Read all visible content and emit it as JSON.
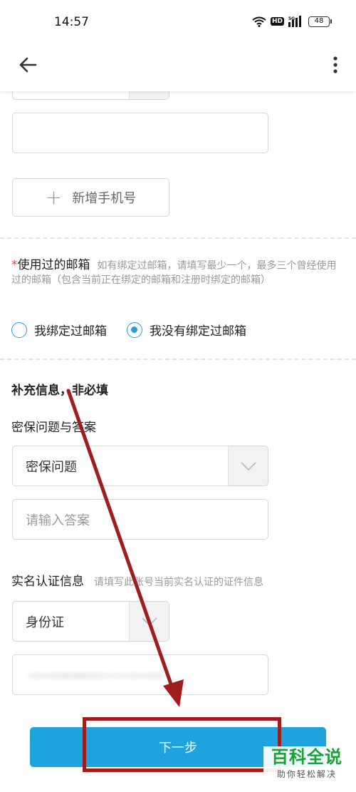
{
  "status_bar": {
    "time": "14:57",
    "hd": "HD",
    "network": "5G",
    "battery": "48"
  },
  "nav": {
    "back_icon": "arrow-left-icon",
    "more_icon": "more-vertical-icon"
  },
  "phone_section": {
    "add_phone_label": "新增手机号"
  },
  "email_section": {
    "required_mark": "*",
    "label": "使用过的邮箱",
    "hint": "如有绑定过邮箱，请填写最少一个，最多三个曾经使用过的邮箱（包含当前正在绑定的邮箱和注册时绑定的邮箱）",
    "options": [
      {
        "label": "我绑定过邮箱",
        "checked": false
      },
      {
        "label": "我没有绑定过邮箱",
        "checked": true
      }
    ]
  },
  "supplement": {
    "title": "补充信息，非必填",
    "security_label": "密保问题与答案",
    "question_select": "密保问题",
    "answer_placeholder": "请输入答案",
    "realname_label": "实名认证信息",
    "realname_hint": "请填写此账号当前实名认证的证件信息",
    "id_type_select": "身份证"
  },
  "next_button": "下一步",
  "watermark": {
    "title": "百科全说",
    "subtitle": "助你轻松解决"
  },
  "colors": {
    "accent": "#1ea3dc",
    "radio": "#2b9bd6",
    "required": "#e64340",
    "annotation": "#a11d1d",
    "watermark": "#1aa03a"
  }
}
